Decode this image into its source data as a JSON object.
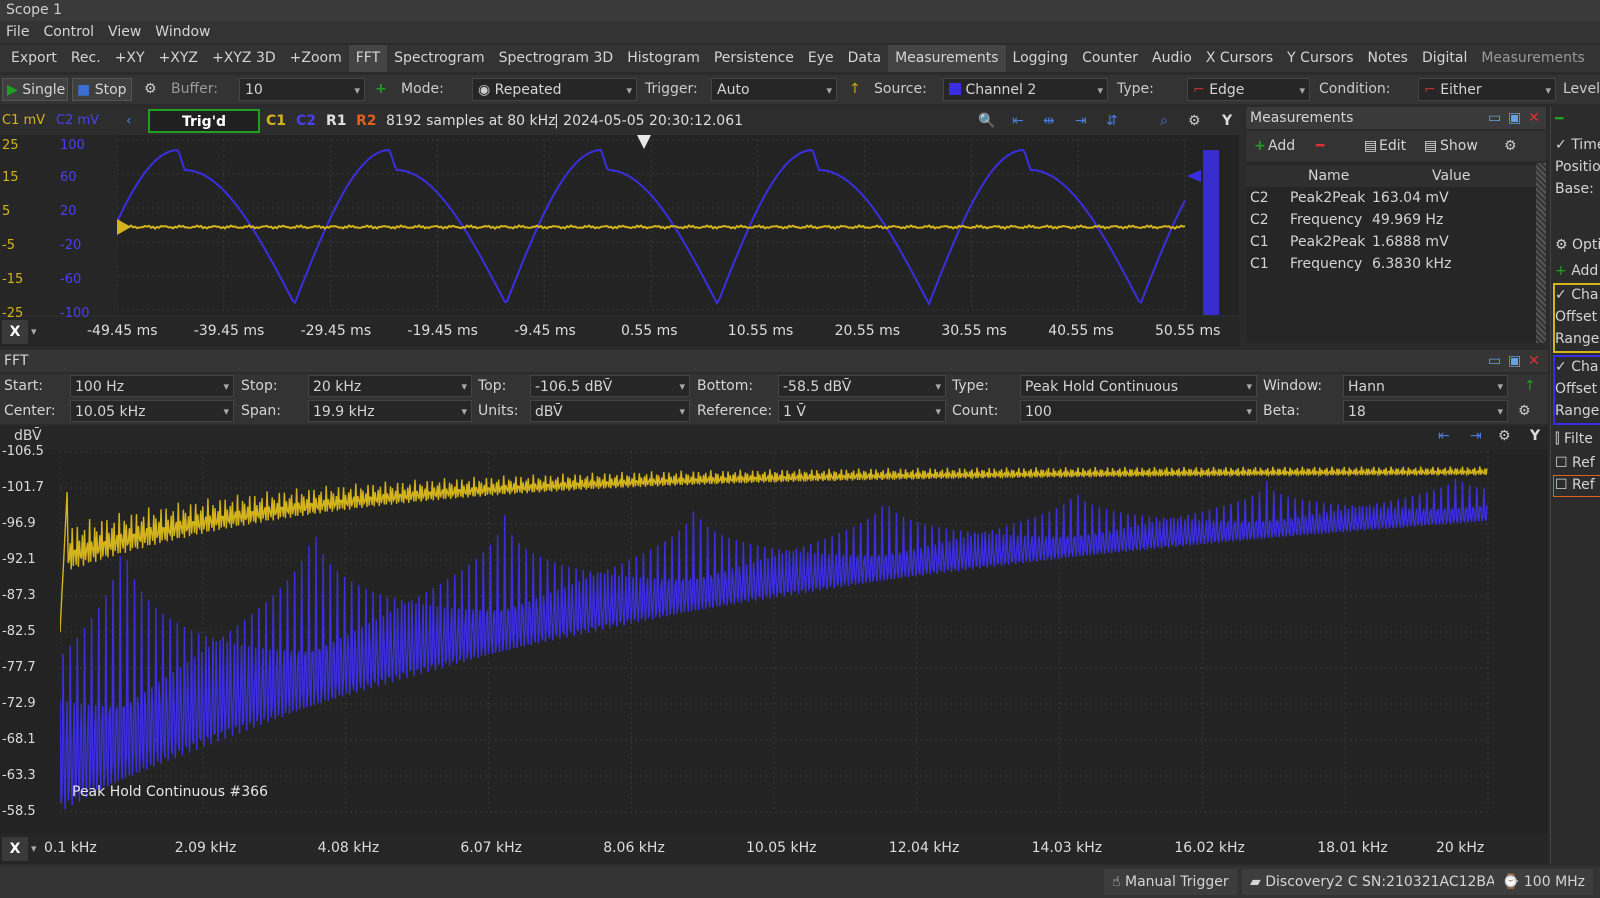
{
  "window": {
    "title": "Scope 1"
  },
  "menu": [
    "File",
    "Control",
    "View",
    "Window"
  ],
  "toolbar": {
    "items": [
      "Export",
      "Rec.",
      "+XY",
      "+XYZ",
      "+XYZ 3D",
      "+Zoom",
      "FFT",
      "Spectrogram",
      "Spectrogram 3D",
      "Histogram",
      "Persistence",
      "Eye",
      "Data",
      "Measurements",
      "Logging",
      "Counter",
      "Audio",
      "X Cursors",
      "Y Cursors",
      "Notes",
      "Digital",
      "Measurements"
    ],
    "active": [
      "FFT",
      "Measurements"
    ]
  },
  "acq": {
    "single": "Single",
    "stop": "Stop",
    "buffer_label": "Buffer:",
    "buffer_value": "10",
    "mode_label": "Mode:",
    "mode_value": "Repeated",
    "trigger_label": "Trigger:",
    "trigger_value": "Auto",
    "source_label": "Source:",
    "source_value": "Channel 2",
    "type_label": "Type:",
    "type_value": "Edge",
    "condition_label": "Condition:",
    "condition_value": "Either",
    "level_label": "Level:"
  },
  "scope": {
    "c1_unit": "C1 mV",
    "c2_unit": "C2 mV",
    "status": "Trig'd",
    "channels": [
      "C1",
      "C2",
      "R1",
      "R2"
    ],
    "info": "8192 samples at 80 kHz",
    "timestamp": "| 2024-05-05 20:30:12.061",
    "c1_ticks": [
      "25",
      "15",
      "5",
      "-5",
      "-15",
      "-25"
    ],
    "c2_ticks": [
      "100",
      "60",
      "20",
      "-20",
      "-60",
      "-100"
    ],
    "x_ticks": [
      "-49.45 ms",
      "-39.45 ms",
      "-29.45 ms",
      "-19.45 ms",
      "-9.45 ms",
      "0.55 ms",
      "10.55 ms",
      "20.55 ms",
      "30.55 ms",
      "40.55 ms",
      "50.55 ms"
    ],
    "x_axis_btn": "X"
  },
  "measurements": {
    "title": "Measurements",
    "add": "Add",
    "edit": "Edit",
    "show": "Show",
    "col_name": "Name",
    "col_value": "Value",
    "rows": [
      {
        "ch": "C2",
        "name": "Peak2Peak",
        "value": "163.04 mV"
      },
      {
        "ch": "C2",
        "name": "Frequency",
        "value": "49.969 Hz"
      },
      {
        "ch": "C1",
        "name": "Peak2Peak",
        "value": "1.6888 mV"
      },
      {
        "ch": "C1",
        "name": "Frequency",
        "value": "6.3830 kHz"
      }
    ]
  },
  "fft": {
    "title": "FFT",
    "start_label": "Start:",
    "start_value": "100 Hz",
    "stop_label": "Stop:",
    "stop_value": "20 kHz",
    "top_label": "Top:",
    "top_value": "-106.5 dBV̄",
    "bottom_label": "Bottom:",
    "bottom_value": "-58.5 dBV̄",
    "type_label": "Type:",
    "type_value": "Peak Hold Continuous",
    "window_label": "Window:",
    "window_value": "Hann",
    "center_label": "Center:",
    "center_value": "10.05 kHz",
    "span_label": "Span:",
    "span_value": "19.9 kHz",
    "units_label": "Units:",
    "units_value": "dBV̄",
    "ref_label": "Reference:",
    "ref_value": "1 V̄",
    "count_label": "Count:",
    "count_value": "100",
    "beta_label": "Beta:",
    "beta_value": "18",
    "y_unit": "dBV̄",
    "y_ticks": [
      "-106.5",
      "-101.7",
      "-96.9",
      "-92.1",
      "-87.3",
      "-82.5",
      "-77.7",
      "-72.9",
      "-68.1",
      "-63.3",
      "-58.5"
    ],
    "x_ticks": [
      "0.1 kHz",
      "2.09 kHz",
      "4.08 kHz",
      "6.07 kHz",
      "8.06 kHz",
      "10.05 kHz",
      "12.04 kHz",
      "14.03 kHz",
      "16.02 kHz",
      "18.01 kHz",
      "20 kHz"
    ],
    "overlay": "Peak Hold Continuous #366",
    "x_axis_btn": "X"
  },
  "side": {
    "items": [
      "Time",
      "Positio",
      "Base:",
      "Optio",
      "Add",
      "Cha",
      "Offset",
      "Range",
      "Cha",
      "Offset",
      "Range",
      "Filte",
      "Ref",
      "Ref"
    ]
  },
  "status": {
    "trigger": "Manual Trigger",
    "device": "Discovery2 C SN:210321AC12BA",
    "clock": "100 MHz"
  },
  "colors": {
    "c1": "#d4b41c",
    "c2": "#3a2fe0",
    "accent": "#1fa01f",
    "bg": "#232323"
  }
}
